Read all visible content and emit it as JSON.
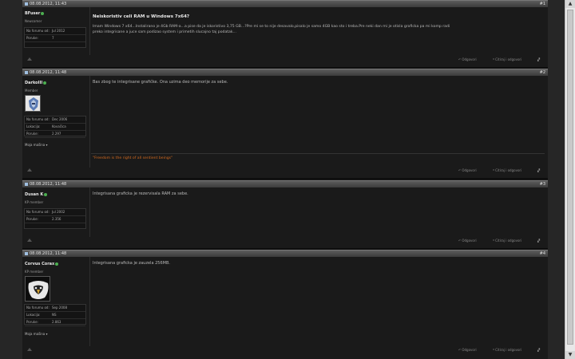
{
  "posts": [
    {
      "date": "08.08.2012, 11:43",
      "number": "#1",
      "username": "BFuser",
      "rank": "Newcomer",
      "info": [
        {
          "k": "Na forumu od:",
          "v": "Jul 2012"
        },
        {
          "k": "Poruke:",
          "v": "7"
        }
      ],
      "title": "Neiskoristiv celi RAM u Windows 7x64?",
      "message_lines": [
        "Imam Windows 7 x64...Instalirano je 4Gb RAM-a...a pise da je iskoristivo 3,75 GB...?Pre mi se to nije desavalo,pisalo je samo 4GB kao sto i treba.Pre neki dan mi je otisla graficka pa mi komp radi",
        "preko integrisane a juce sam podizao system i primetih slucajno taj podatak..."
      ]
    },
    {
      "date": "08.08.2012, 11:48",
      "number": "#2",
      "username": "DarkoIII",
      "rank": "Member",
      "info": [
        {
          "k": "Na forumu od:",
          "v": "Dec 2006"
        },
        {
          "k": "Lokacija:",
          "v": "Kovačica"
        },
        {
          "k": "Poruke:",
          "v": "2.297"
        }
      ],
      "more": "Moja mašina ▾",
      "message_lines": [
        "Bas zbog te integrisane grafičke. Ona uzima deo memorije za sebe."
      ],
      "signature": "\"Freedom is the right of all sentient beings\""
    },
    {
      "date": "08.08.2012, 11:48",
      "number": "#3",
      "username": "Dusan K",
      "rank": "KP member",
      "info": [
        {
          "k": "Na forumu od:",
          "v": "Jul 2002"
        },
        {
          "k": "Poruke:",
          "v": "2.356"
        }
      ],
      "message_lines": [
        "Integrisana graficka je rezervisala RAM za sebe."
      ]
    },
    {
      "date": "08.08.2012, 11:48",
      "number": "#4",
      "username": "Corvus Corax",
      "rank": "KP member",
      "info": [
        {
          "k": "Na forumu od:",
          "v": "Sep 2008"
        },
        {
          "k": "Lokacija:",
          "v": "NS"
        },
        {
          "k": "Poruke:",
          "v": "2.863"
        }
      ],
      "more": "Moja mašina ▾",
      "message_lines": [
        "Integrisana graficka je zauzela 256MB."
      ]
    }
  ],
  "actions": {
    "reply": "Odgovori",
    "quote": "Citiraj i odgovori"
  }
}
